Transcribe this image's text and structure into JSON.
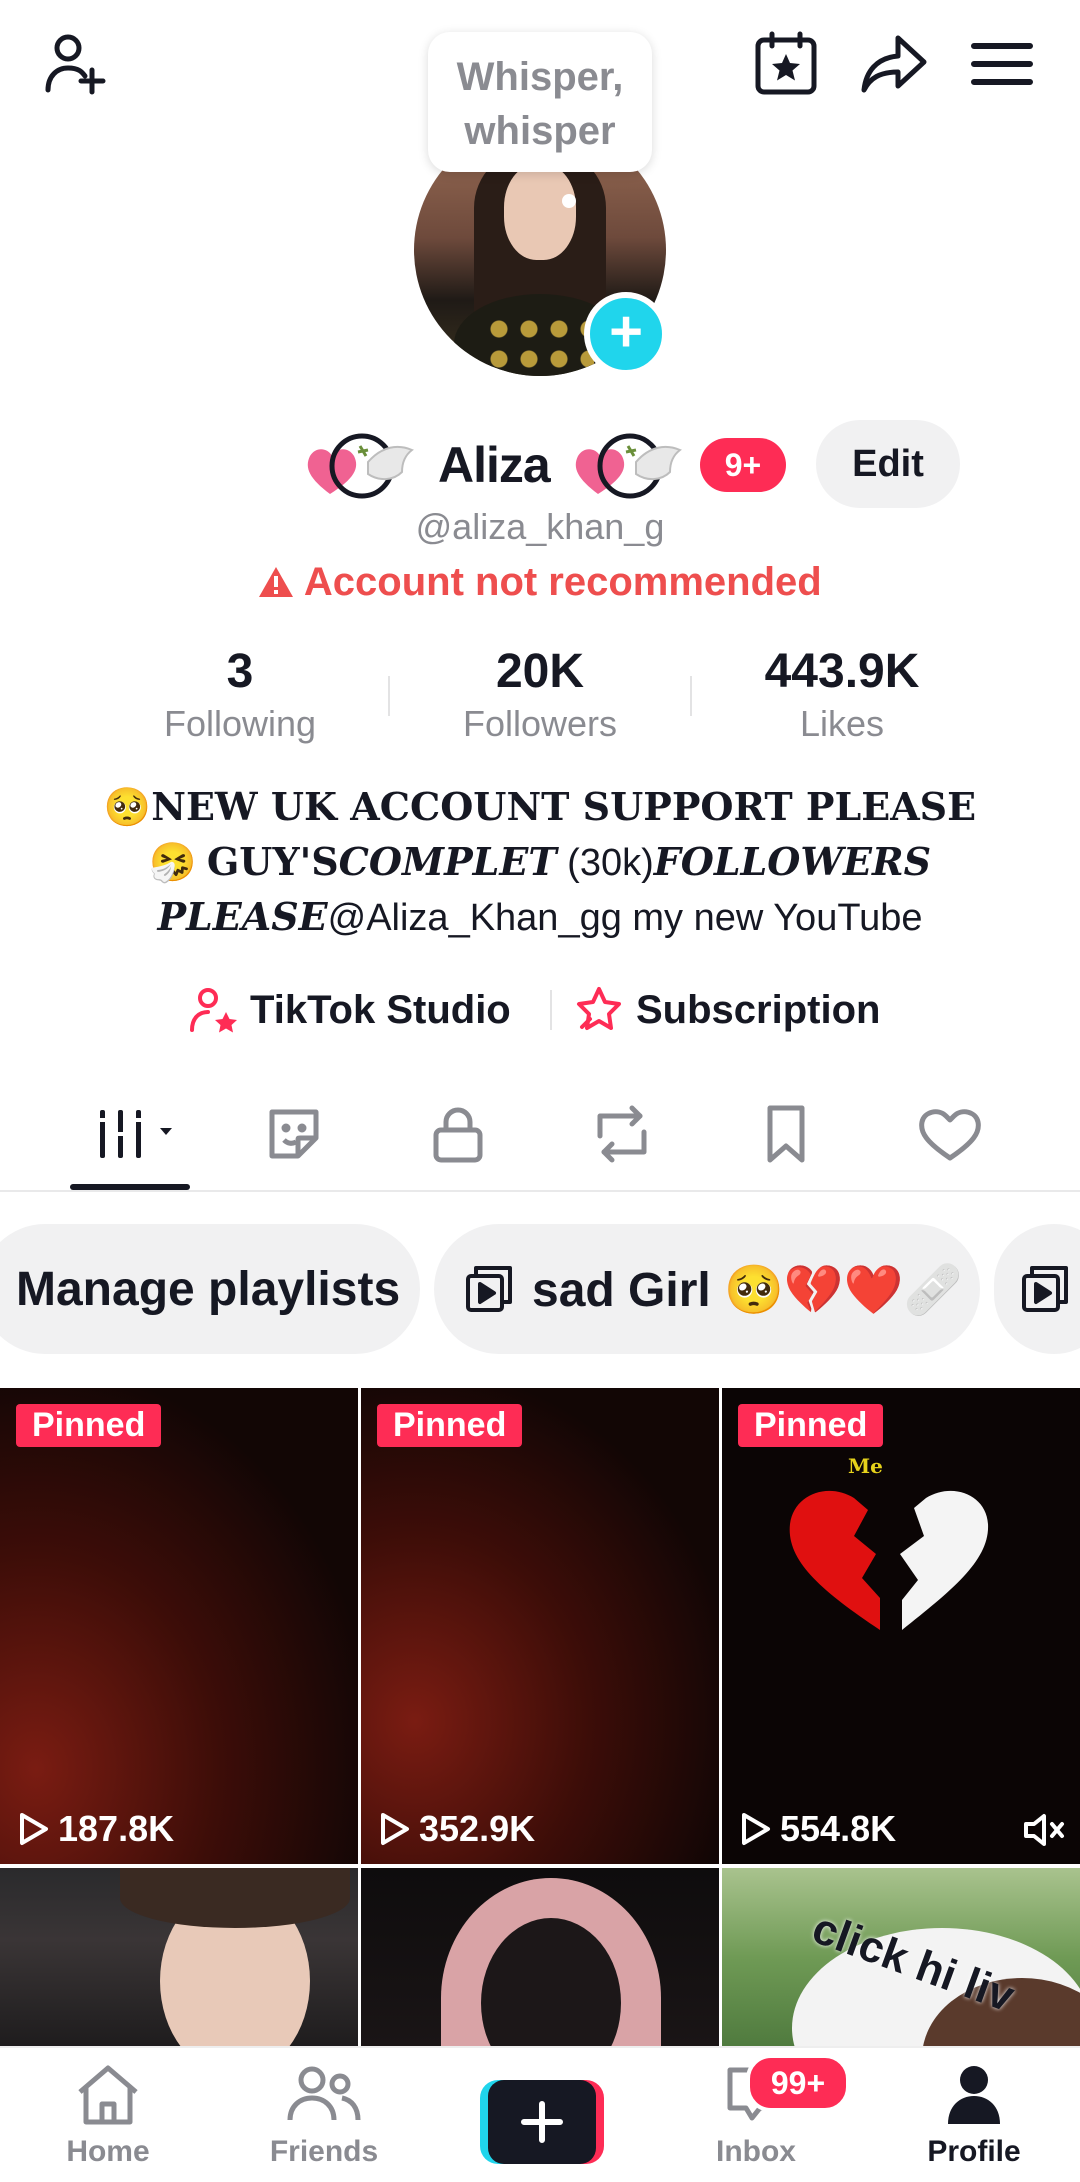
{
  "header": {
    "add_friend_icon": "person-plus-icon",
    "calendar_icon": "calendar-star-icon",
    "share_icon": "share-arrow-icon",
    "menu_icon": "hamburger-menu-icon"
  },
  "status_bubble": {
    "line1": "Whisper,",
    "line2": "whisper"
  },
  "profile": {
    "name": "Aliza",
    "notifications_badge": "9+",
    "edit_label": "Edit",
    "handle": "@aliza_khan_g",
    "warning": "Account not recommended"
  },
  "stats": [
    {
      "value": "3",
      "label": "Following"
    },
    {
      "value": "20K",
      "label": "Followers"
    },
    {
      "value": "443.9K",
      "label": "Likes"
    }
  ],
  "bio": {
    "emoji1": "🥺",
    "line1": "NEW UK ACCOUNT SUPPORT PLEASE",
    "emoji2": "🤧",
    "line2a": "GUY'S",
    "line2b": "COMPLET",
    "line2c": " (30k)",
    "line2d": "FOLLOWERS",
    "line3a": "PLEASE",
    "line3b": "@Aliza_Khan_gg my new YouTube"
  },
  "links": {
    "studio": "TikTok Studio",
    "subscription": "Subscription"
  },
  "tabs": [
    "videos-grid",
    "stickers",
    "private",
    "reposts",
    "saved",
    "liked"
  ],
  "playlists": [
    {
      "label": "Manage playlists"
    },
    {
      "label": "sad Girl 🥺💔❤️🩹"
    },
    {
      "label": ""
    }
  ],
  "videos": [
    {
      "pinned": "Pinned",
      "views": "187.8K"
    },
    {
      "pinned": "Pinned",
      "views": "352.9K"
    },
    {
      "pinned": "Pinned",
      "views": "554.8K",
      "me_label": "Me"
    },
    {
      "overlay": ""
    },
    {
      "overlay": ""
    },
    {
      "overlay": "click hi liv"
    }
  ],
  "bottom_nav": {
    "home": "Home",
    "friends": "Friends",
    "inbox": "Inbox",
    "inbox_badge": "99+",
    "profile": "Profile"
  },
  "colors": {
    "accent": "#fe2c55",
    "cyan": "#20d5ec",
    "warning": "#ee4e4e",
    "muted": "#8a8b91"
  }
}
